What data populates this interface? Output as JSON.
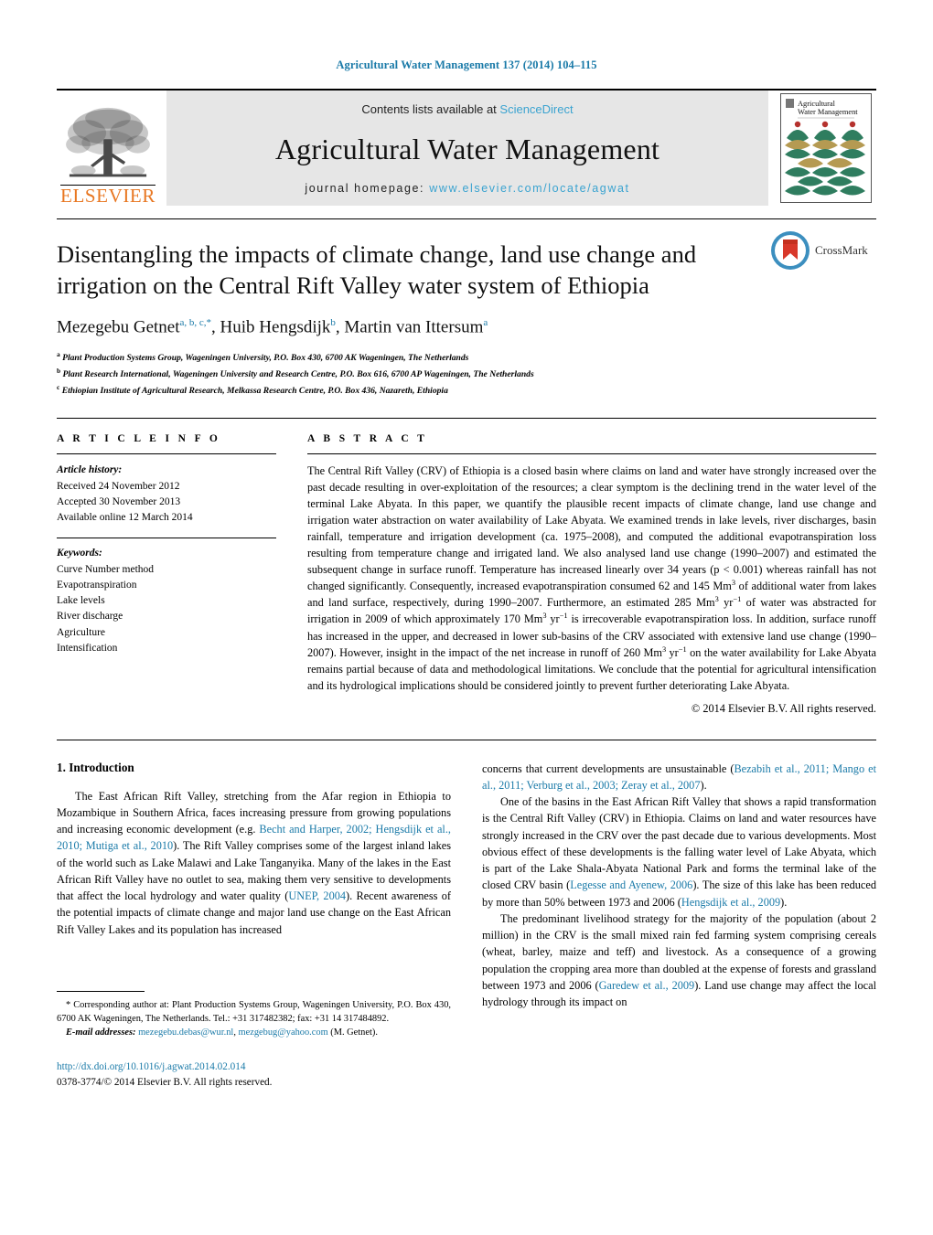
{
  "running_head": "Agricultural Water Management 137 (2014) 104–115",
  "masthead": {
    "contents_prefix": "Contents lists available at ",
    "sciencedirect": "ScienceDirect",
    "journal_title": "Agricultural Water Management",
    "homepage_prefix": "journal homepage: ",
    "homepage_url": "www.elsevier.com/locate/agwat",
    "elsevier_wordmark": "ELSEVIER",
    "cover_title_line1": "Agricultural",
    "cover_title_line2": "Water Management",
    "colors": {
      "link": "#3aa3d0",
      "elsevier_orange": "#E87722",
      "masthead_bg": "#e6e6e6",
      "cover_green": "#2f7d5f",
      "cover_gold": "#b59a52",
      "cover_red": "#b5322e"
    }
  },
  "article": {
    "title": "Disentangling the impacts of climate change, land use change and irrigation on the Central Rift Valley water system of Ethiopia",
    "authors": [
      {
        "name": "Mezegebu Getnet",
        "sups": "a, b, c,*"
      },
      {
        "name": "Huib Hengsdijk",
        "sups": "b"
      },
      {
        "name": "Martin van Ittersum",
        "sups": "a"
      }
    ],
    "affiliations": [
      {
        "marker": "a",
        "text": "Plant Production Systems Group, Wageningen University, P.O. Box 430, 6700 AK Wageningen, The Netherlands"
      },
      {
        "marker": "b",
        "text": "Plant Research International, Wageningen University and Research Centre, P.O. Box 616, 6700 AP Wageningen, The Netherlands"
      },
      {
        "marker": "c",
        "text": "Ethiopian Institute of Agricultural Research, Melkassa Research Centre, P.O. Box 436, Nazareth, Ethiopia"
      }
    ],
    "crossmark_label": "CrossMark"
  },
  "article_info": {
    "heading": "A R T I C L E    I N F O",
    "history_label": "Article history:",
    "history": [
      "Received 24 November 2012",
      "Accepted 30 November 2013",
      "Available online 12 March 2014"
    ],
    "keywords_label": "Keywords:",
    "keywords": [
      "Curve Number method",
      "Evapotranspiration",
      "Lake levels",
      "River discharge",
      "Agriculture",
      "Intensification"
    ]
  },
  "abstract": {
    "heading": "A B S T R A C T",
    "part1": "The Central Rift Valley (CRV) of Ethiopia is a closed basin where claims on land and water have strongly increased over the past decade resulting in over-exploitation of the resources; a clear symptom is the declining trend in the water level of the terminal Lake Abyata. In this paper, we quantify the plausible recent impacts of climate change, land use change and irrigation water abstraction on water availability of Lake Abyata. We examined trends in lake levels, river discharges, basin rainfall, temperature and irrigation development (ca. 1975–2008), and computed the additional evapotranspiration loss resulting from temperature change and irrigated land. We also analysed land use change (1990–2007) and estimated the subsequent change in surface runoff. Temperature has increased linearly over 34 years (p < 0.001) whereas rainfall has not changed significantly. Consequently, increased evapotranspiration consumed 62 and 145 Mm",
    "sup1": "3",
    "part2": " of additional water from lakes and land surface, respectively, during 1990–2007. Furthermore, an estimated 285 Mm",
    "sup2": "3",
    "part3": " yr",
    "sup3": "−1",
    "part4": " of water was abstracted for irrigation in 2009 of which approximately 170 Mm",
    "sup4": "3",
    "part5": " yr",
    "sup5": "−1",
    "part6": " is irrecoverable evapotranspiration loss. In addition, surface runoff has increased in the upper, and decreased in lower sub-basins of the CRV associated with extensive land use change (1990–2007). However, insight in the impact of the net increase in runoff of 260 Mm",
    "sup6": "3",
    "part7": " yr",
    "sup7": "−1",
    "part8": " on the water availability for Lake Abyata remains partial because of data and methodological limitations. We conclude that the potential for agricultural intensification and its hydrological implications should be considered jointly to prevent further deteriorating Lake Abyata.",
    "copyright": "© 2014 Elsevier B.V. All rights reserved."
  },
  "introduction": {
    "heading": "1. Introduction",
    "left_p1_a": "The East African Rift Valley, stretching from the Afar region in Ethiopia to Mozambique in Southern Africa, faces increasing pressure from growing populations and increasing economic development (e.g. ",
    "left_p1_cite1": "Becht and Harper, 2002; Hengsdijk et al., 2010; Mutiga et al., 2010",
    "left_p1_b": "). The Rift Valley comprises some of the largest inland lakes of the world such as Lake Malawi and Lake Tanganyika. Many of the lakes in the East African Rift Valley have no outlet to sea, making them very sensitive to developments that affect the local hydrology and water quality (",
    "left_p1_cite2": "UNEP, 2004",
    "left_p1_c": "). Recent awareness of the potential impacts of climate change and major land use change on the East African Rift Valley Lakes and its population has increased ",
    "right_p1_a": "concerns that current developments are unsustainable (",
    "right_p1_cite1": "Bezabih et al., 2011; Mango et al., 2011; Verburg et al., 2003; Zeray et al., 2007",
    "right_p1_b": ").",
    "right_p2_a": "One of the basins in the East African Rift Valley that shows a rapid transformation is the Central Rift Valley (CRV) in Ethiopia. Claims on land and water resources have strongly increased in the CRV over the past decade due to various developments. Most obvious effect of these developments is the falling water level of Lake Abyata, which is part of the Lake Shala-Abyata National Park and forms the terminal lake of the closed CRV basin (",
    "right_p2_cite1": "Legesse and Ayenew, 2006",
    "right_p2_b": "). The size of this lake has been reduced by more than 50% between 1973 and 2006 (",
    "right_p2_cite2": "Hengsdijk et al., 2009",
    "right_p2_c": ").",
    "right_p3_a": "The predominant livelihood strategy for the majority of the population (about 2 million) in the CRV is the small mixed rain fed farming system comprising cereals (wheat, barley, maize and teff) and livestock. As a consequence of a growing population the cropping area more than doubled at the expense of forests and grassland between 1973 and 2006 (",
    "right_p3_cite1": "Garedew et al., 2009",
    "right_p3_b": "). Land use change may affect the local hydrology through its impact on"
  },
  "footnote": {
    "corresponding": "* Corresponding author at: Plant Production Systems Group, Wageningen University, P.O. Box 430, 6700 AK Wageningen, The Netherlands. Tel.: +31 317482382; fax: +31 14 317484892.",
    "email_label": "E-mail addresses:",
    "email1": "mezegebu.debas@wur.nl",
    "email_sep": ", ",
    "email2": "mezgebug@yahoo.com",
    "email_suffix": " (M. Getnet)."
  },
  "doi_block": {
    "doi": "http://dx.doi.org/10.1016/j.agwat.2014.02.014",
    "issn_line": "0378-3774/© 2014 Elsevier B.V. All rights reserved."
  }
}
